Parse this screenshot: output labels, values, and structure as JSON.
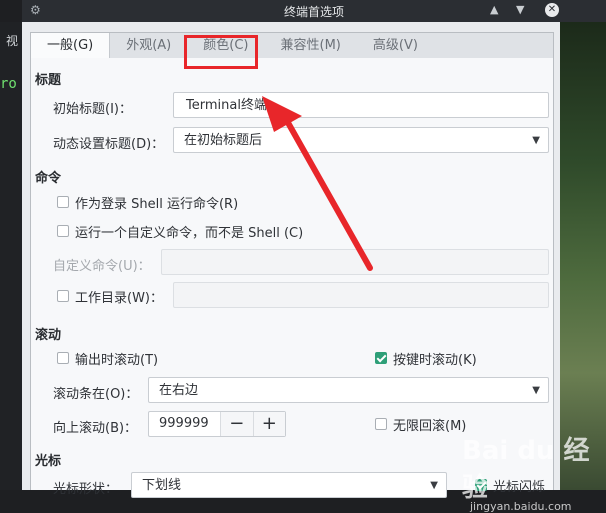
{
  "window": {
    "title": "终端首选项"
  },
  "background": {
    "left_text_1": "视",
    "left_text_2": "ro"
  },
  "tabs": [
    {
      "label": "一般(G)",
      "active": true
    },
    {
      "label": "外观(A)",
      "active": false
    },
    {
      "label": "颜色(C)",
      "active": false
    },
    {
      "label": "兼容性(M)",
      "active": false
    },
    {
      "label": "高级(V)",
      "active": false
    }
  ],
  "sections": {
    "title": {
      "heading": "标题",
      "initial_title_label": "初始标题(I)：",
      "initial_title_value": "Terminal终端",
      "dynamic_title_label": "动态设置标题(D)：",
      "dynamic_title_value": "在初始标题后"
    },
    "command": {
      "heading": "命令",
      "login_shell": {
        "label": "作为登录 Shell 运行命令(R)",
        "checked": false
      },
      "custom_command": {
        "label": "运行一个自定义命令，而不是 Shell (C)",
        "checked": false
      },
      "custom_command_label": "自定义命令(U)：",
      "working_dir": {
        "label": "工作目录(W)：",
        "checked": false
      }
    },
    "scroll": {
      "heading": "滚动",
      "scroll_on_output": {
        "label": "输出时滚动(T)",
        "checked": false
      },
      "scroll_on_key": {
        "label": "按键时滚动(K)",
        "checked": true
      },
      "scrollbar_label": "滚动条在(O)：",
      "scrollbar_value": "在右边",
      "scrollback_label": "向上滚动(B)：",
      "scrollback_value": "999999",
      "minus": "−",
      "plus": "+",
      "unlimited": {
        "label": "无限回滚(M)",
        "checked": false
      }
    },
    "cursor": {
      "heading": "光标",
      "shape_label": "光标形状：",
      "shape_value": "下划线",
      "blink": {
        "label": "光标闪烁",
        "checked": true
      }
    }
  },
  "colors": {
    "accent": "#2e9f78",
    "highlight": "#e8262a"
  },
  "watermark": {
    "brand": "Bai du 经验",
    "url": "jingyan.baidu.com"
  }
}
